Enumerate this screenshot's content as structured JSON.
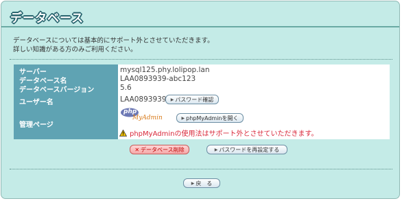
{
  "page": {
    "title": "データベース",
    "description_line1": "データベースについては基本的にサポート外とさせていただきます。",
    "description_line2": "詳しい知識がある方のみご利用ください。"
  },
  "info": {
    "server_label": "サーバー",
    "server_value": "mysql125.phy.lolipop.lan",
    "dbname_label": "データベース名",
    "dbname_value": "LAA0893939-abc123",
    "dbversion_label": "データベースバージョン",
    "dbversion_value": "5.6",
    "user_label": "ユーザー名",
    "user_value": "LAA0893939",
    "password_confirm_button": "パスワード確認",
    "admin_label": "管理ページ",
    "phpmyadmin_logo_text_top": "php",
    "phpmyadmin_logo_text_bottom": "MyAdmin",
    "open_phpmyadmin_button": "phpMyAdminを開く",
    "warning_text": "phpMyAdminの使用法はサポート外とさせていただきます。"
  },
  "actions": {
    "delete_db_button": "データベース削除",
    "reset_password_button": "パスワードを再設定する",
    "back_button": "戻　る"
  },
  "colors": {
    "panel_bg": "#c4ebe7",
    "label_col_bg": "#5fa3b3",
    "warning_text": "#d9283a",
    "title_outline": "#23606b"
  }
}
